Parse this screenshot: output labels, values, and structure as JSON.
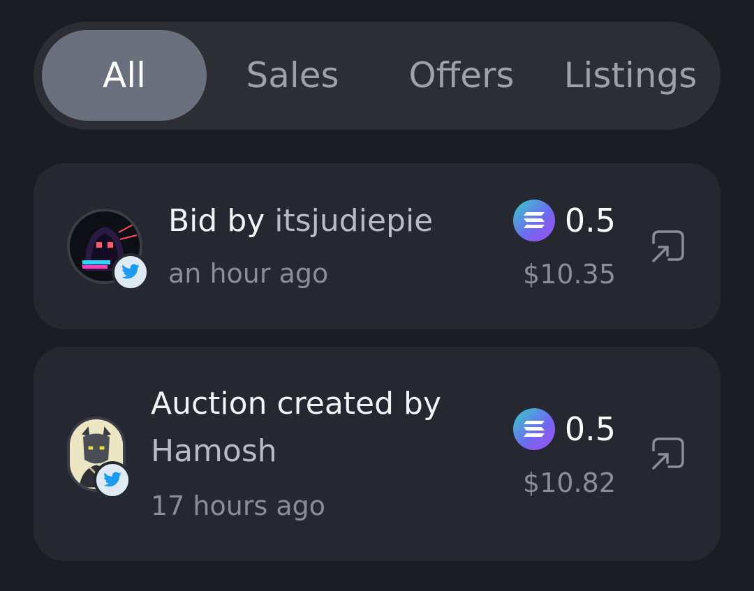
{
  "tabs": [
    {
      "label": "All",
      "active": true
    },
    {
      "label": "Sales",
      "active": false
    },
    {
      "label": "Offers",
      "active": false
    },
    {
      "label": "Listings",
      "active": false
    }
  ],
  "activity": [
    {
      "title_prefix": "Bid by ",
      "user": "itsjudiepie",
      "time": "an hour ago",
      "price": "0.5",
      "usd": "$10.35",
      "avatar_icon": "hooded-pixel-avatar",
      "badge_icon": "twitter-icon",
      "currency_icon": "solana-icon",
      "action_icon": "external-link-icon"
    },
    {
      "title_prefix": "Auction created by ",
      "user": "Hamosh",
      "time": "17 hours ago",
      "price": "0.5",
      "usd": "$10.82",
      "avatar_icon": "horned-character-avatar",
      "badge_icon": "twitter-icon",
      "currency_icon": "solana-icon",
      "action_icon": "external-link-icon"
    }
  ],
  "colors": {
    "background": "#1b1d22",
    "tab_bar": "#2c2e34",
    "tab_active": "#6b707e",
    "card": "#252830",
    "twitter_blue": "#1d9bf0"
  }
}
